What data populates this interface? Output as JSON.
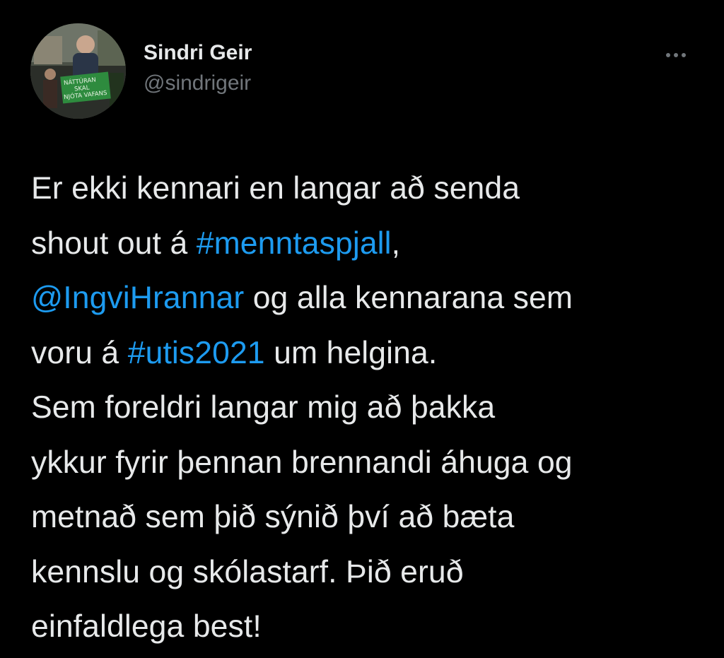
{
  "author": {
    "display_name": "Sindri Geir",
    "handle": "@sindrigeir",
    "avatar_sign_text": [
      "NÁTTÚRAN",
      "SKAL",
      "NJÓTA VAFANS"
    ]
  },
  "more_icon": "more-horizontal-icon",
  "tweet": {
    "lines": [
      [
        {
          "t": "text",
          "v": "Er ekki kennari en langar að senda"
        }
      ],
      [
        {
          "t": "text",
          "v": "shout out á "
        },
        {
          "t": "link",
          "v": "#menntaspjall"
        },
        {
          "t": "text",
          "v": ","
        }
      ],
      [
        {
          "t": "link",
          "v": "@IngviHrannar"
        },
        {
          "t": "text",
          "v": " og alla kennarana sem"
        }
      ],
      [
        {
          "t": "text",
          "v": "voru á "
        },
        {
          "t": "link",
          "v": "#utis2021"
        },
        {
          "t": "text",
          "v": " um helgina."
        }
      ],
      [
        {
          "t": "text",
          "v": "Sem foreldri langar mig að þakka"
        }
      ],
      [
        {
          "t": "text",
          "v": "ykkur fyrir þennan brennandi áhuga og"
        }
      ],
      [
        {
          "t": "text",
          "v": "metnað sem þið sýnið því að bæta"
        }
      ],
      [
        {
          "t": "text",
          "v": "kennslu og skólastarf. Þið eruð"
        }
      ],
      [
        {
          "t": "text",
          "v": "einfaldlega best!"
        }
      ]
    ]
  },
  "colors": {
    "background": "#000000",
    "text": "#e7e9ea",
    "secondary_text": "#71767b",
    "link": "#1d9bf0"
  }
}
